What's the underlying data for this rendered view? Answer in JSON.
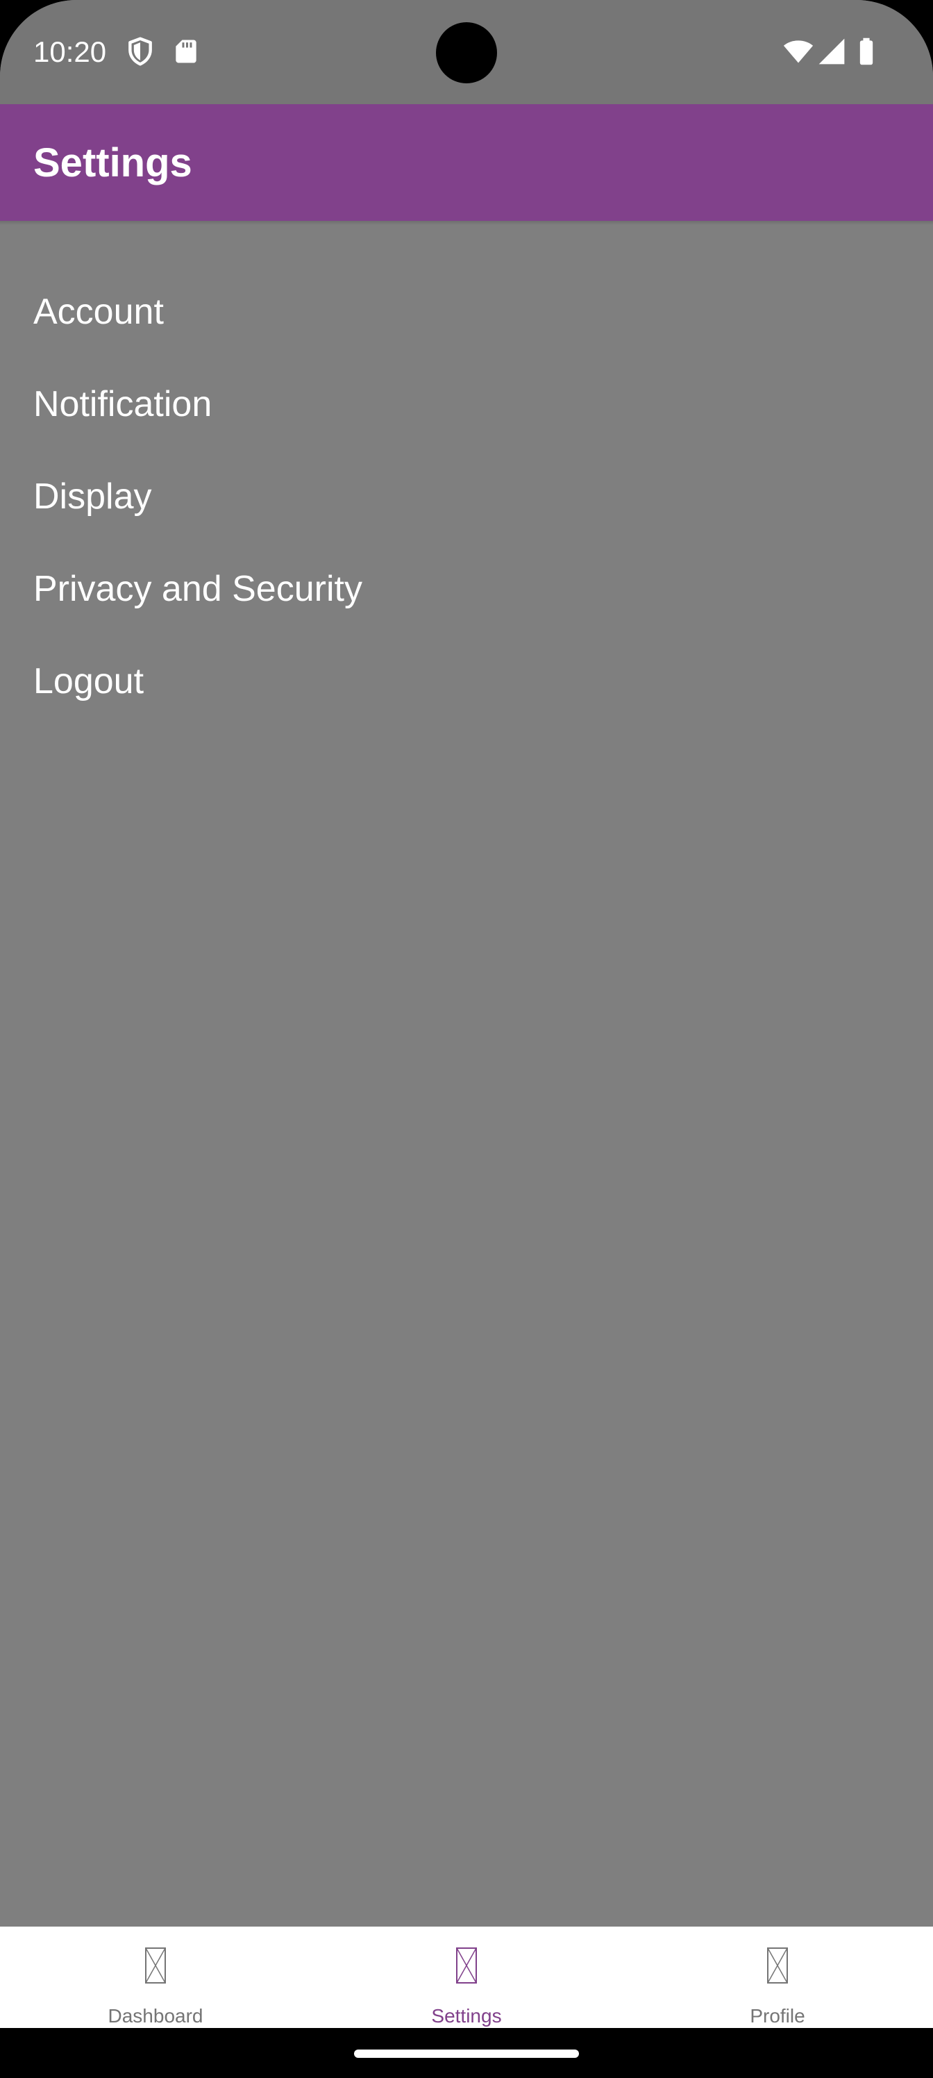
{
  "status_bar": {
    "time": "10:20",
    "icons_left": [
      "shield-icon",
      "sd-card-icon"
    ],
    "icons_right": [
      "wifi-icon",
      "cell-signal-icon",
      "battery-icon"
    ]
  },
  "app_bar": {
    "title": "Settings",
    "color": "#81418b"
  },
  "settings": {
    "items": [
      {
        "label": "Account"
      },
      {
        "label": "Notification"
      },
      {
        "label": "Display"
      },
      {
        "label": "Privacy and Security"
      },
      {
        "label": "Logout"
      }
    ]
  },
  "bottom_nav": {
    "items": [
      {
        "label": "Dashboard",
        "icon": "missing-image-icon",
        "active": false
      },
      {
        "label": "Settings",
        "icon": "missing-image-icon",
        "active": true
      },
      {
        "label": "Profile",
        "icon": "missing-image-icon",
        "active": false
      }
    ],
    "active_color": "#81418b",
    "inactive_color": "#757575"
  }
}
